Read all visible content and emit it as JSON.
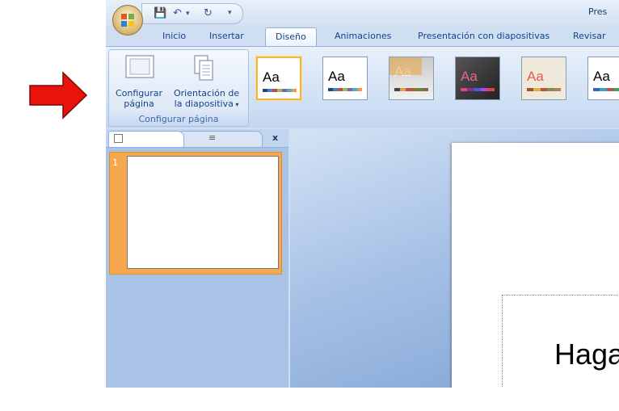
{
  "window": {
    "title": "Pres"
  },
  "quick_access": {
    "save_icon": "save-icon",
    "undo_icon": "undo-icon",
    "redo_icon": "redo-icon"
  },
  "tabs": [
    {
      "label": "Inicio",
      "active": false
    },
    {
      "label": "Insertar",
      "active": false
    },
    {
      "label": "Diseño",
      "active": true
    },
    {
      "label": "Animaciones",
      "active": false
    },
    {
      "label": "Presentación con diapositivas",
      "active": false
    },
    {
      "label": "Revisar",
      "active": false
    }
  ],
  "ribbon": {
    "page_setup_group": {
      "label": "Configurar página",
      "configure_button": {
        "line1": "Configurar",
        "line2": "página"
      },
      "orientation_button": {
        "line1": "Orientación de",
        "line2": "la diapositiva"
      }
    },
    "themes": [
      {
        "label": "Aa",
        "text_color": "#000000",
        "bg": "#ffffff"
      },
      {
        "label": "Aa",
        "text_color": "#000000",
        "bg": "#ffffff"
      },
      {
        "label": "Aa",
        "text_color": "#ffffff",
        "bg": "#e8e8e8"
      },
      {
        "label": "Aa",
        "text_color": "#f06292",
        "bg": "#3a3a3a"
      },
      {
        "label": "Aa",
        "text_color": "#e35d4a",
        "bg": "#efe9dc"
      },
      {
        "label": "Aa",
        "text_color": "#000000",
        "bg": "#ffffff"
      }
    ]
  },
  "slides_panel": {
    "slide_number": "1",
    "close_label": "x"
  },
  "slide": {
    "placeholder_text": "Haga"
  },
  "colors": {
    "arrow": "#e8130b",
    "accent": "#15428b",
    "selection": "#f6a84c"
  }
}
